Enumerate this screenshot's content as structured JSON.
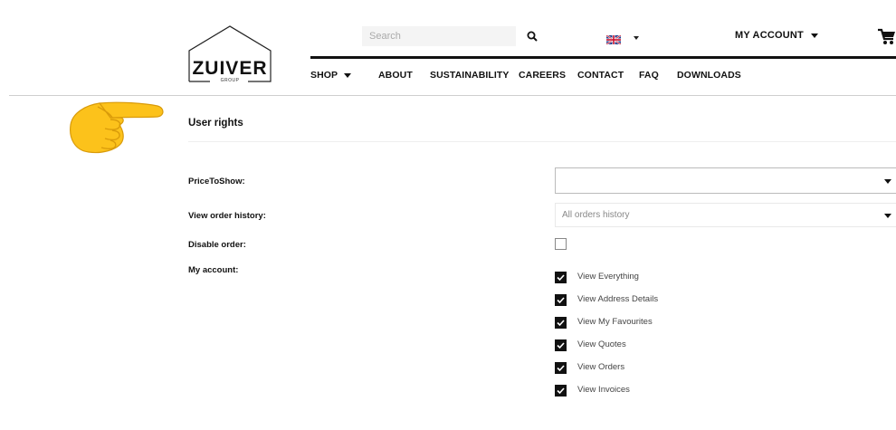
{
  "logo": {
    "word": "ZUIVER",
    "sub": "GROUP"
  },
  "header": {
    "search": {
      "placeholder": "Search",
      "value": "",
      "icon": "search-icon"
    },
    "language": {
      "icon": "uk-flag-icon"
    },
    "account_label": "MY ACCOUNT",
    "cart_icon": "shopping-cart-icon"
  },
  "nav": {
    "items": [
      "SHOP",
      "ABOUT",
      "SUSTAINABILITY",
      "CAREERS",
      "CONTACT",
      "FAQ",
      "DOWNLOADS"
    ]
  },
  "pointer_icon": "pointing-hand-emoji",
  "section": {
    "title": "User rights"
  },
  "fields": {
    "price_to_show": {
      "label": "PriceToShow:",
      "value": ""
    },
    "view_order_history": {
      "label": "View order history:",
      "value": "All orders history"
    },
    "disable_order": {
      "label": "Disable order:",
      "checked": false
    },
    "my_account": {
      "label": "My account:",
      "options": [
        {
          "label": "View Everything",
          "checked": true
        },
        {
          "label": "View Address Details",
          "checked": true
        },
        {
          "label": "View My Favourites",
          "checked": true
        },
        {
          "label": "View Quotes",
          "checked": true
        },
        {
          "label": "View Orders",
          "checked": true
        },
        {
          "label": "View Invoices",
          "checked": true
        }
      ]
    }
  },
  "colors": {
    "text": "#111111",
    "accent": "#111111",
    "border": "#bbbbbb",
    "divider": "#cfcfcf"
  }
}
